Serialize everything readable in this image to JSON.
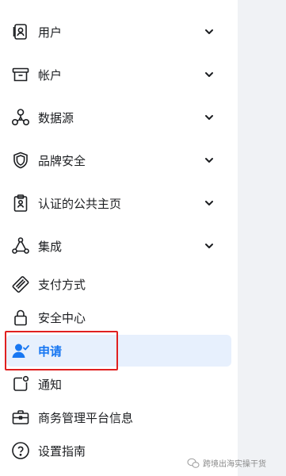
{
  "sidebar": {
    "items": [
      {
        "label": "用户",
        "icon": "user-card-icon",
        "expandable": true
      },
      {
        "label": "帐户",
        "icon": "archive-box-icon",
        "expandable": true
      },
      {
        "label": "数据源",
        "icon": "data-sources-icon",
        "expandable": true
      },
      {
        "label": "品牌安全",
        "icon": "shield-icon",
        "expandable": true
      },
      {
        "label": "认证的公共主页",
        "icon": "clipboard-icon",
        "expandable": true
      },
      {
        "label": "集成",
        "icon": "network-icon",
        "expandable": true
      },
      {
        "label": "支付方式",
        "icon": "credit-card-icon",
        "expandable": false
      },
      {
        "label": "安全中心",
        "icon": "lock-icon",
        "expandable": false
      },
      {
        "label": "申请",
        "icon": "person-check-icon",
        "expandable": false,
        "active": true
      },
      {
        "label": "通知",
        "icon": "notification-icon",
        "expandable": false
      },
      {
        "label": "商务管理平台信息",
        "icon": "briefcase-icon",
        "expandable": false
      },
      {
        "label": "设置指南",
        "icon": "help-icon",
        "expandable": false
      }
    ]
  },
  "watermark": {
    "text": "跨境出海实操干货"
  },
  "colors": {
    "accent": "#1877f2",
    "active_bg": "#e7f0fd",
    "highlight": "#e02020"
  }
}
